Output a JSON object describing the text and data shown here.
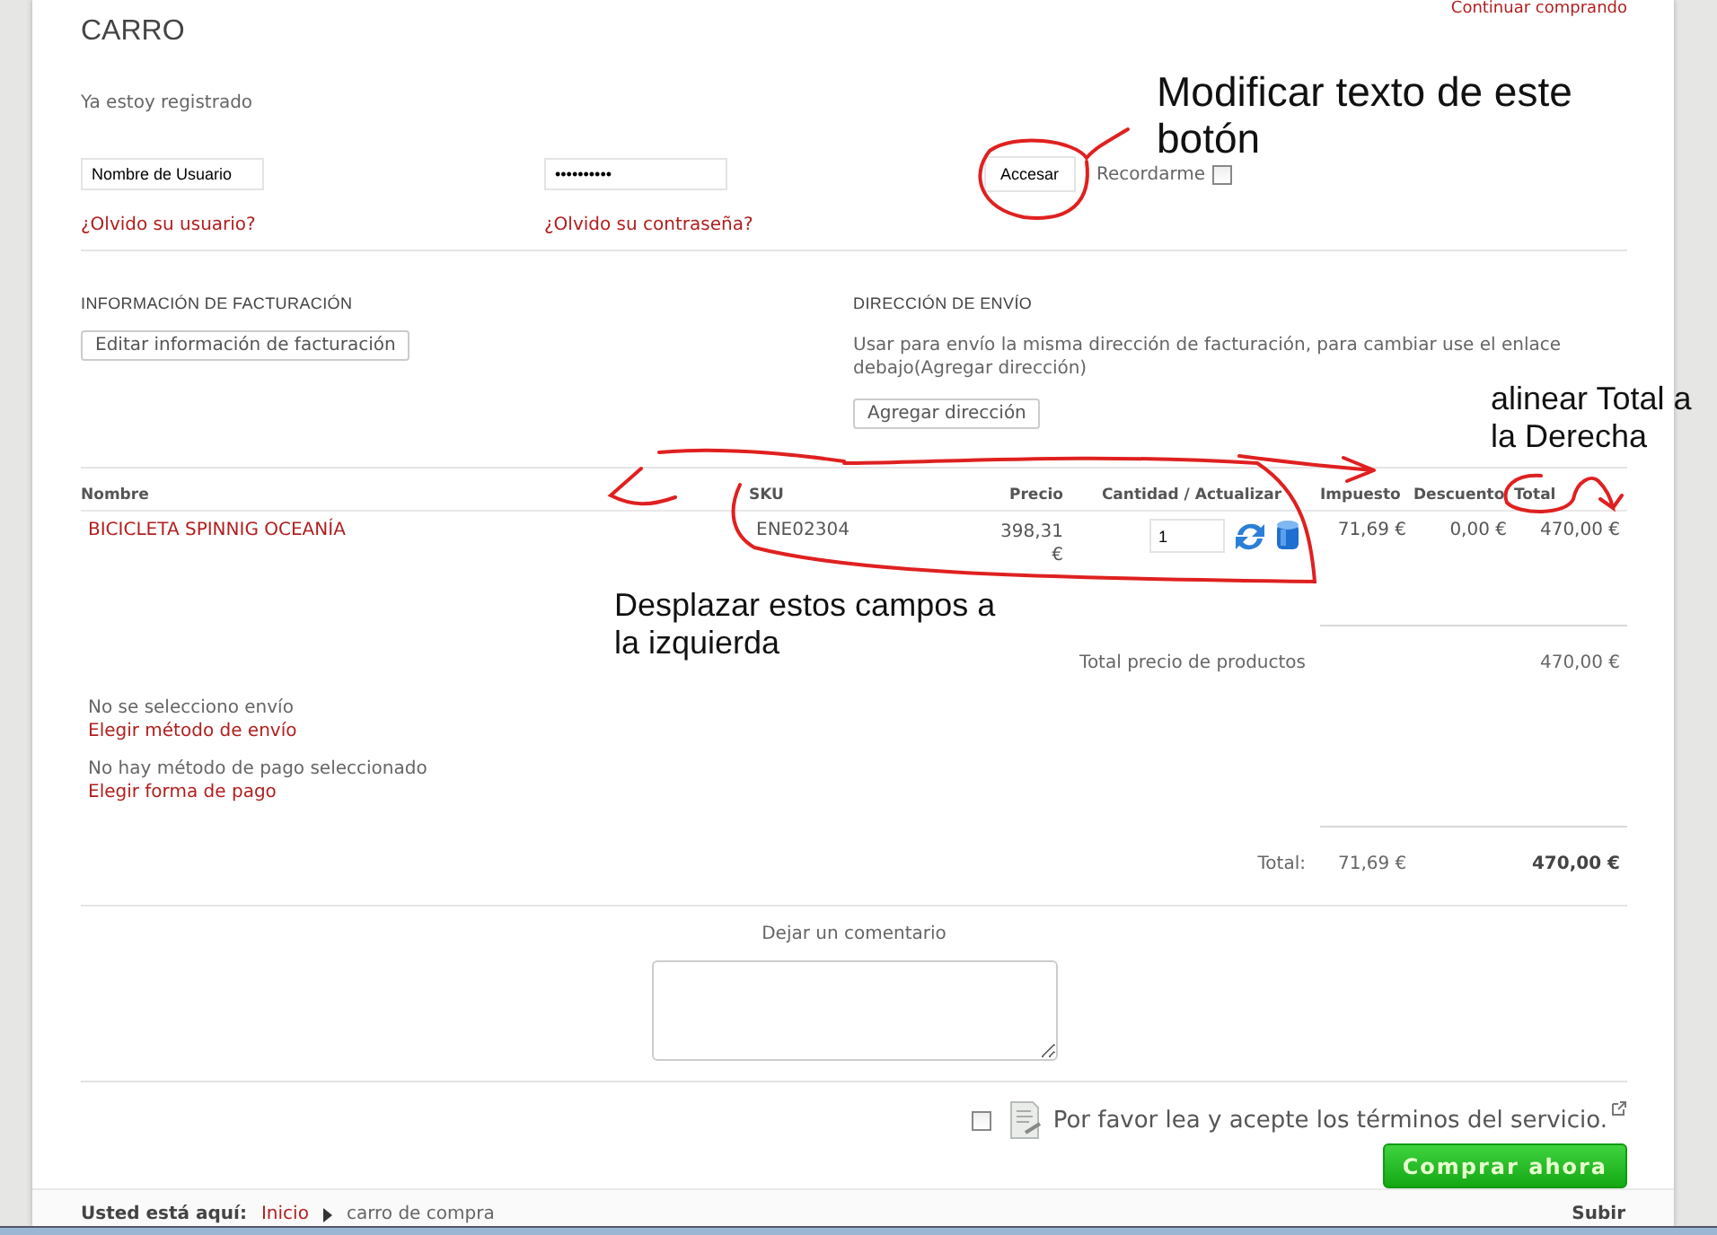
{
  "header": {
    "continue_link": "Continuar comprando",
    "title": "CARRO"
  },
  "login": {
    "heading": "Ya estoy registrado",
    "username": {
      "value": "Nombre de Usuario"
    },
    "password": {
      "value": "••••••••••"
    },
    "submit": "Accesar",
    "remember": {
      "label": "Recordarme",
      "checked": false
    },
    "forgot_user": "¿Olvido su usuario?",
    "forgot_password": "¿Olvido su contraseña?"
  },
  "billing": {
    "heading": "INFORMACIÓN DE FACTURACIÓN",
    "button": "Editar información de facturación"
  },
  "shipping": {
    "heading": "DIRECCIÓN DE ENVÍO",
    "note": "Usar para envío la misma dirección de facturación, para cambiar use el enlace debajo(Agregar dirección)",
    "button": "Agregar dirección"
  },
  "table": {
    "columns": [
      "Nombre",
      "SKU",
      "Precio",
      "Cantidad / Actualizar",
      "Impuesto",
      "Descuento",
      "Total"
    ],
    "rows": [
      {
        "name": "BICICLETA SPINNIG OCEANÍA",
        "sku": "ENE02304",
        "price": "398,31 €",
        "quantity": "1",
        "tax": "71,69 €",
        "discount": "0,00 €",
        "total": "470,00 €"
      }
    ]
  },
  "subtotal": {
    "label": "Total precio de productos",
    "value": "470,00 €"
  },
  "shipping_method": {
    "status": "No se selecciono envío",
    "link": "Elegir método de envío"
  },
  "payment_method": {
    "status": "No hay método de pago seleccionado",
    "link": "Elegir forma de pago"
  },
  "totals": {
    "label": "Total:",
    "tax": "71,69 €",
    "total": "470,00 €"
  },
  "comment": {
    "label": "Dejar un comentario"
  },
  "terms": {
    "checked": false,
    "text": "Por favor lea y acepte los términos del servicio."
  },
  "buy_button": "Comprar ahora",
  "breadcrumb": {
    "label": "Usted está aquí:",
    "link": "Inicio",
    "current": "carro de compra"
  },
  "back_to_top": "Subir",
  "annotations": [
    {
      "text": "Modificar texto de este botón"
    },
    {
      "text": "alinear Total a la Derecha"
    },
    {
      "text": "Desplazar estos campos a la izquierda"
    }
  ]
}
